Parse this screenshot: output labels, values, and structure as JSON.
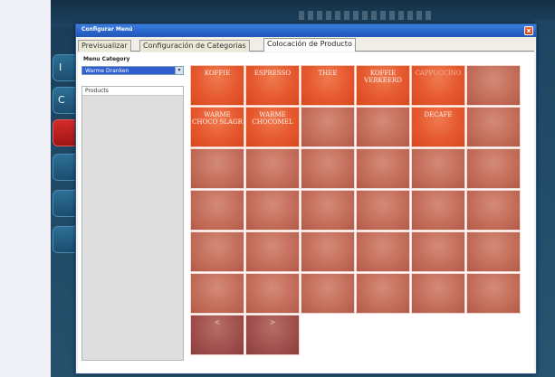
{
  "dialog": {
    "title": "Configurar Menú",
    "close_label": "x"
  },
  "tabs": [
    {
      "label": "Previsualizar",
      "active": false
    },
    {
      "label": "Configuración de Categorias",
      "active": false
    },
    {
      "label": "Colocación de Producto",
      "active": true
    }
  ],
  "left_panel": {
    "menu_category_label": "Menu Category",
    "menu_category_value": "Warme Dranken",
    "products_header": "Products"
  },
  "grid": {
    "columns": 6,
    "rows": 7,
    "cells": [
      {
        "label": "KOFFIE",
        "filled": true
      },
      {
        "label": "ESPRESSO",
        "filled": true
      },
      {
        "label": "THEE",
        "filled": true
      },
      {
        "label": "KOFFIE VERKEERD",
        "filled": true
      },
      {
        "label": "CAPPUCCINO",
        "filled": true,
        "dim": true
      },
      {
        "label": "",
        "filled": false
      },
      {
        "label": "WARME CHOCO SLAGR",
        "filled": true
      },
      {
        "label": "WARME CHOCOMEL",
        "filled": true
      },
      {
        "label": "",
        "filled": false
      },
      {
        "label": "",
        "filled": false
      },
      {
        "label": "DECAFE",
        "filled": true
      },
      {
        "label": "",
        "filled": false
      }
    ],
    "nav_prev": "<",
    "nav_next": ">"
  },
  "background": {
    "side_letters": [
      "I",
      "C"
    ]
  },
  "colors": {
    "titlebar": "#2862c8",
    "product_button": "#e6592f",
    "empty_slot": "#c46f5c",
    "nav_button": "#9f4f4c"
  }
}
